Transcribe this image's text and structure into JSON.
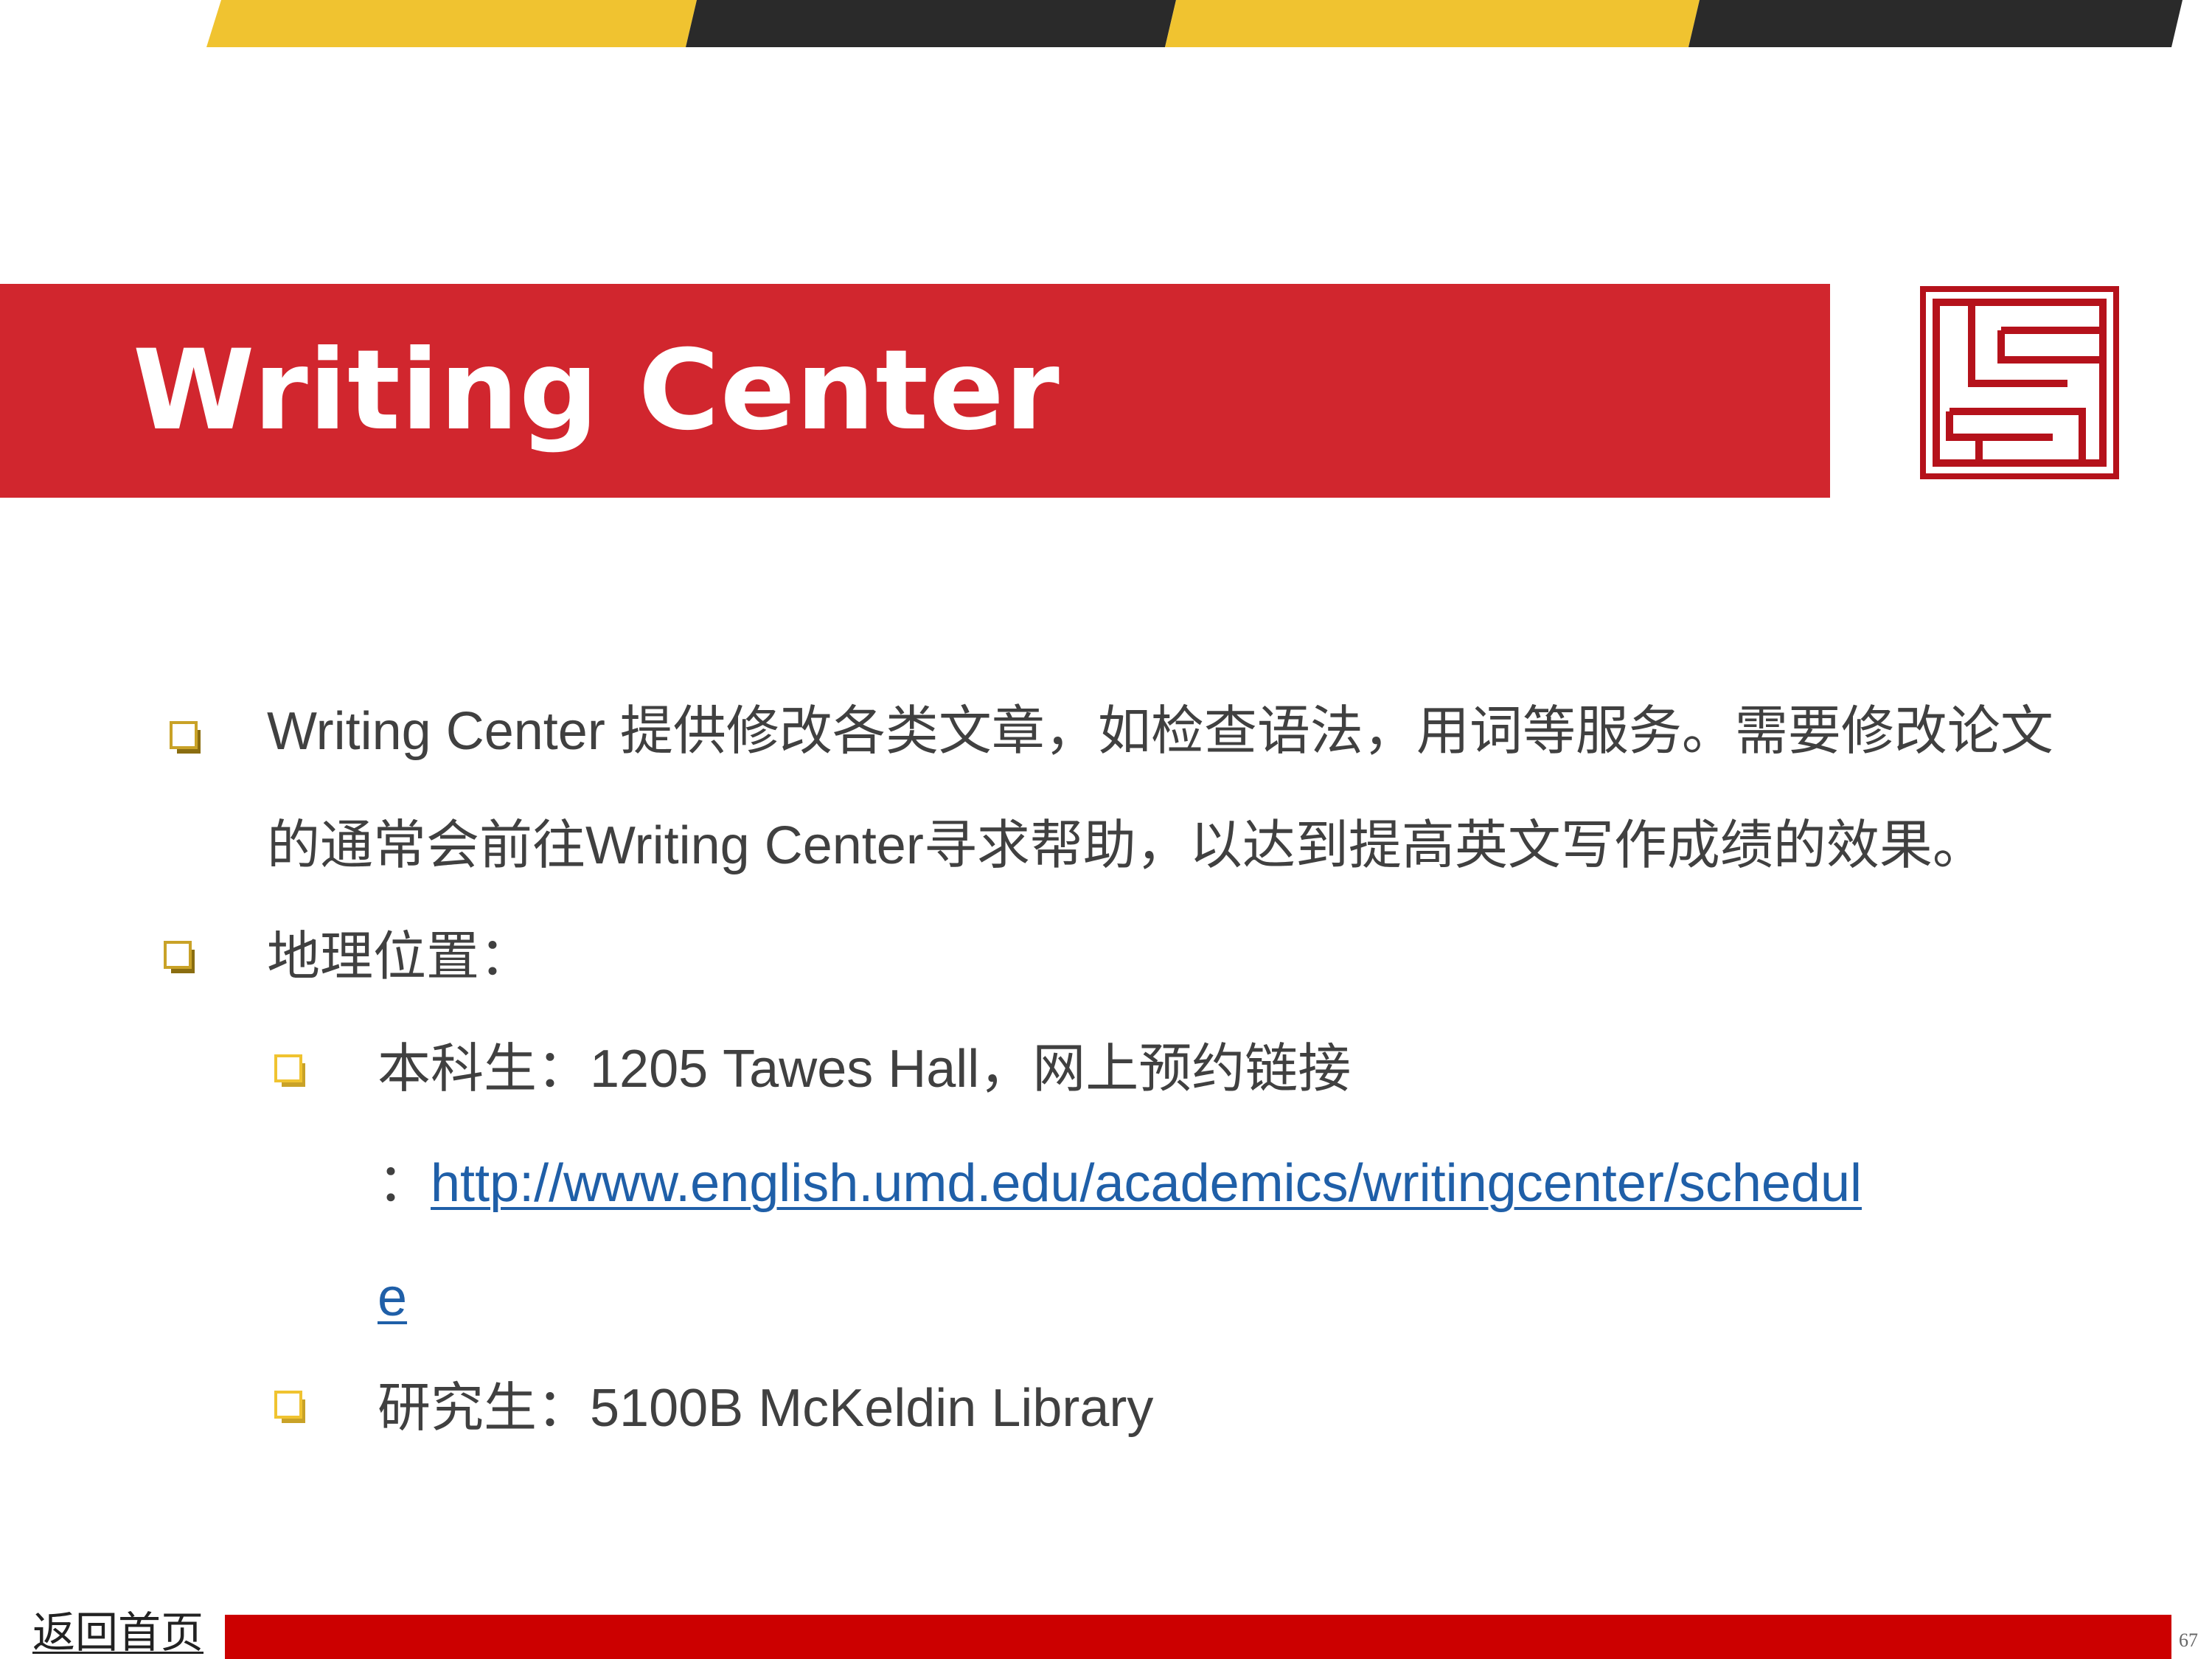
{
  "slide": {
    "title": "Writing Center",
    "page_number": "67",
    "home_link_label": "返回首页"
  },
  "colors": {
    "accent_red": "#d1262e",
    "stripe_yellow": "#f0c330",
    "stripe_black": "#2a2a2a",
    "footer_red": "#cc0000",
    "bullet_gold": "#c9a227",
    "bullet_yellow": "#f0c330",
    "link_blue": "#1f5fa8"
  },
  "icons": {
    "logo": "seal-logo-icon",
    "bullet": "checkbox-bullet-icon"
  },
  "content": {
    "intro_line1": "Writing Center 提供修改各类文章，如检查语法，用词等服务。需要修改论文",
    "intro_line2": "的通常会前往Writing Center寻求帮助，以达到提高英文写作成绩的效果。",
    "location_heading": "地理位置：",
    "undergrad_prefix": "本科生：1205 Tawes Hall，网上预约链接",
    "undergrad_link_colon": "：",
    "undergrad_link_part1": "http://www.english.umd.edu/academics/writingcenter/schedul",
    "undergrad_link_part2": "e",
    "grad_text": "研究生：5100B McKeldin Library"
  }
}
